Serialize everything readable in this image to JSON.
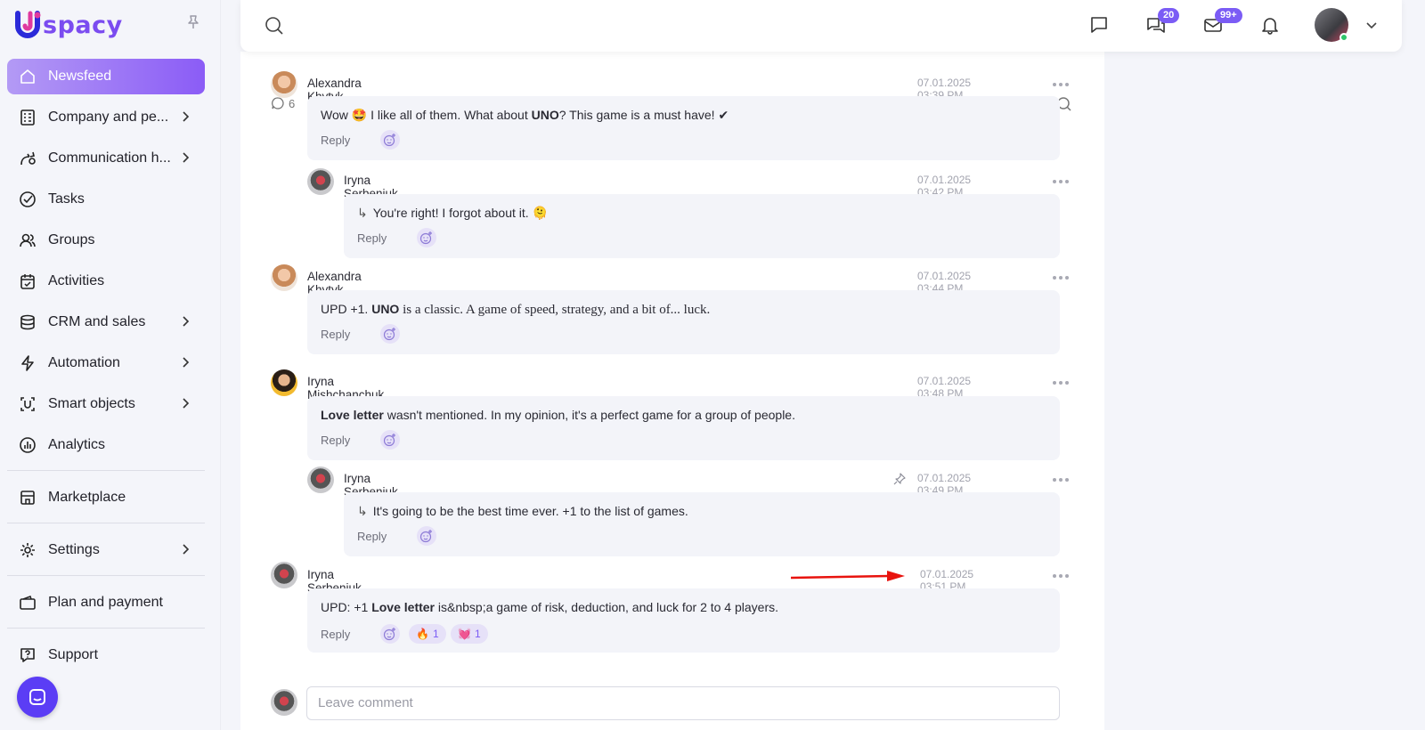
{
  "brand": {
    "name": "spacy"
  },
  "sidebar": {
    "items": [
      {
        "label": "Newsfeed",
        "icon": "home-icon",
        "active": true
      },
      {
        "label": "Company and pe...",
        "icon": "building-icon",
        "chevron": true
      },
      {
        "label": "Communication h...",
        "icon": "communication-icon",
        "chevron": true
      },
      {
        "label": "Tasks",
        "icon": "check-circle-icon"
      },
      {
        "label": "Groups",
        "icon": "users-icon"
      },
      {
        "label": "Activities",
        "icon": "calendar-icon"
      },
      {
        "label": "CRM and sales",
        "icon": "database-icon",
        "chevron": true
      },
      {
        "label": "Automation",
        "icon": "lightning-icon",
        "chevron": true
      },
      {
        "label": "Smart objects",
        "icon": "smart-object-icon",
        "chevron": true
      },
      {
        "label": "Analytics",
        "icon": "chart-icon"
      }
    ],
    "marketplace": "Marketplace",
    "settings": "Settings",
    "plan": "Plan and payment",
    "support": "Support"
  },
  "header": {
    "chat_badge": "20",
    "mail_badge": "99+"
  },
  "feed": {
    "comment_count": "6",
    "reply_label": "Reply",
    "leave_placeholder": "Leave comment",
    "comments": [
      {
        "author": "Alexandra Khytyk",
        "time": "07.01.2025 03:39 PM",
        "pre": "Wow 🤩 I like all of them. What about ",
        "bold": "UNO",
        "post": "? This game is a must have! ✔"
      },
      {
        "author": "Iryna Serbeniuk",
        "time": "07.01.2025 03:42 PM",
        "text": "You're right! I forgot about it. 🫠"
      },
      {
        "author": "Alexandra Khytyk",
        "time": "07.01.2025 03:44 PM",
        "pre": "UPD +1. ",
        "bold": "UNO",
        "post": " is a classic. A game of speed, strategy, and a bit of... luck."
      },
      {
        "author": "Iryna Mishchanchuk",
        "time": "07.01.2025 03:48 PM",
        "bold": "Love letter",
        "post": " wasn't mentioned. In my opinion, it's a perfect game for a group of people."
      },
      {
        "author": "Iryna Serbeniuk",
        "time": "07.01.2025 03:49 PM",
        "text": "It's going to be the best time ever. +1 to the list of games."
      },
      {
        "author": "Iryna Serbeniuk",
        "time": "07.01.2025 03:51 PM",
        "pre": "UPD: +1 ",
        "bold": "Love letter",
        "post": " is&nbsp;a game of risk, deduction, and luck for 2 to 4 players.",
        "reactions": [
          {
            "emoji": "🔥",
            "count": "1"
          },
          {
            "emoji": "💓",
            "count": "1"
          }
        ]
      }
    ]
  },
  "colors": {
    "accent": "#7b5cf5",
    "active_nav": "#8b5cf6",
    "arrow": "#e8130e"
  }
}
